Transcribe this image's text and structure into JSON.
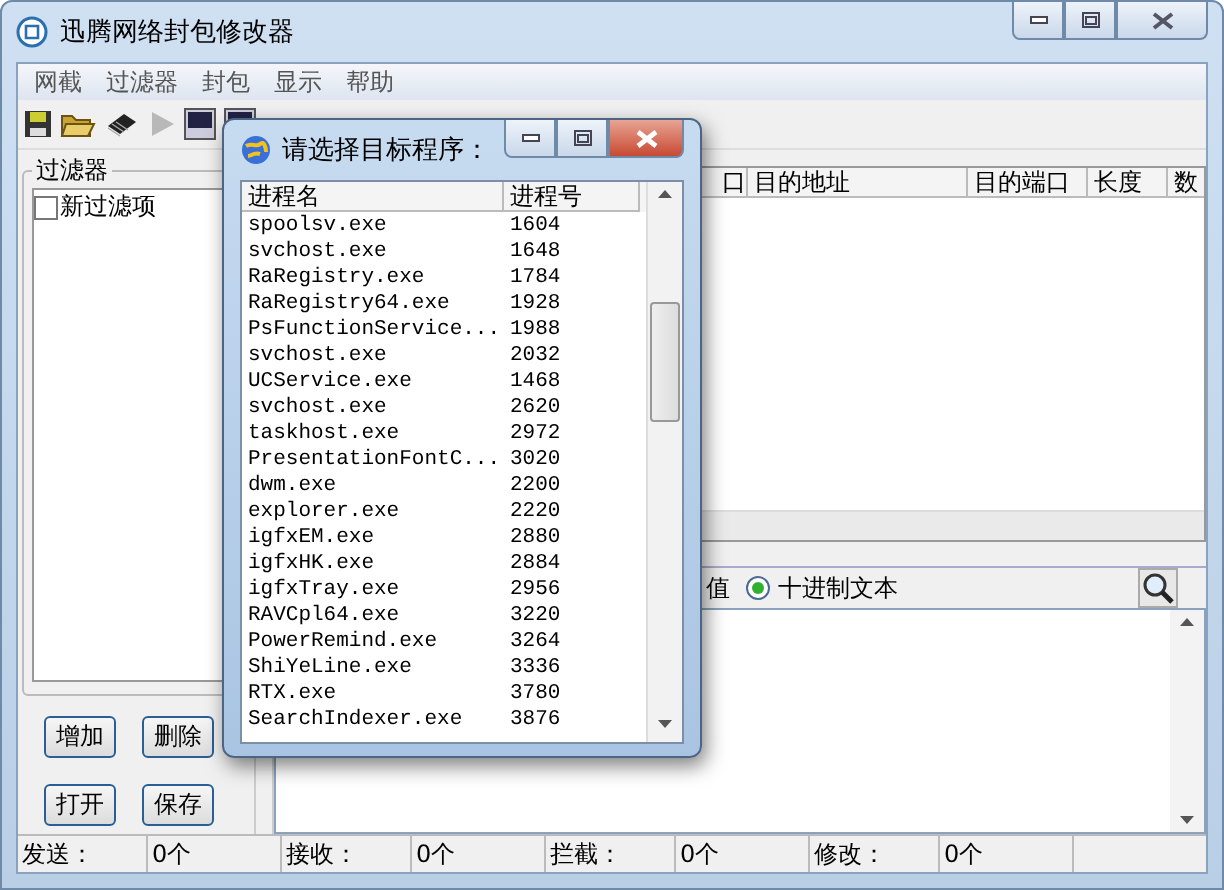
{
  "window": {
    "title": "迅腾网络封包修改器"
  },
  "menu": [
    "网截",
    "过滤器",
    "封包",
    "显示",
    "帮助"
  ],
  "toolbar": [
    {
      "kind": "save",
      "disabled": false
    },
    {
      "kind": "open",
      "disabled": false
    },
    {
      "kind": "chip",
      "disabled": false
    },
    {
      "kind": "play",
      "disabled": true
    },
    {
      "kind": "panel",
      "disabled": false
    },
    {
      "kind": "panel",
      "disabled": false
    }
  ],
  "filter_panel": {
    "title": "过滤器",
    "items": [
      {
        "label": "新过滤项",
        "checked": false
      }
    ],
    "buttons": [
      "增加",
      "删除",
      "打开",
      "保存"
    ]
  },
  "packet_table": {
    "columns": [
      "口",
      "目的地址",
      "目的端口",
      "长度",
      "数"
    ]
  },
  "view_options": [
    {
      "label": "值"
    },
    {
      "label": "十进制文本",
      "selected": true
    }
  ],
  "status_bar": [
    {
      "label": "发送：",
      "value": "0个"
    },
    {
      "label": "接收：",
      "value": "0个"
    },
    {
      "label": "拦截：",
      "value": "0个"
    },
    {
      "label": "修改：",
      "value": "0个"
    }
  ],
  "dialog": {
    "title": "请选择目标程序：",
    "columns": [
      "进程名",
      "进程号"
    ],
    "rows": [
      {
        "name": "spoolsv.exe",
        "pid": "1604"
      },
      {
        "name": "svchost.exe",
        "pid": "1648"
      },
      {
        "name": "RaRegistry.exe",
        "pid": "1784"
      },
      {
        "name": "RaRegistry64.exe",
        "pid": "1928"
      },
      {
        "name": "PsFunctionService...",
        "pid": "1988"
      },
      {
        "name": "svchost.exe",
        "pid": "2032"
      },
      {
        "name": "UCService.exe",
        "pid": "1468"
      },
      {
        "name": "svchost.exe",
        "pid": "2620"
      },
      {
        "name": "taskhost.exe",
        "pid": "2972"
      },
      {
        "name": "PresentationFontC...",
        "pid": "3020"
      },
      {
        "name": "dwm.exe",
        "pid": "2200"
      },
      {
        "name": "explorer.exe",
        "pid": "2220"
      },
      {
        "name": "igfxEM.exe",
        "pid": "2880"
      },
      {
        "name": "igfxHK.exe",
        "pid": "2884"
      },
      {
        "name": "igfxTray.exe",
        "pid": "2956"
      },
      {
        "name": "RAVCpl64.exe",
        "pid": "3220"
      },
      {
        "name": "PowerRemind.exe",
        "pid": "3264"
      },
      {
        "name": "ShiYeLine.exe",
        "pid": "3336"
      },
      {
        "name": "RTX.exe",
        "pid": "3780"
      },
      {
        "name": "SearchIndexer.exe",
        "pid": "3876"
      }
    ]
  }
}
